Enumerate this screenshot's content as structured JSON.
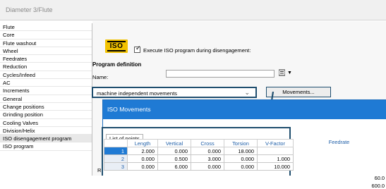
{
  "window": {
    "title": "Diameter 3/Flute"
  },
  "sidebar": {
    "items": [
      {
        "label": "Flute",
        "selected": false
      },
      {
        "label": "Core",
        "selected": false
      },
      {
        "label": "Flute washout",
        "selected": false
      },
      {
        "label": "Wheel",
        "selected": false
      },
      {
        "label": "Feedrates",
        "selected": false
      },
      {
        "label": "Reduction",
        "selected": false
      },
      {
        "label": "Cycles/Infeed",
        "selected": false
      },
      {
        "label": "AC",
        "selected": false
      },
      {
        "label": "Increments",
        "selected": false
      },
      {
        "label": "General",
        "selected": false
      },
      {
        "label": "Change positions",
        "selected": false
      },
      {
        "label": "Grinding position",
        "selected": false
      },
      {
        "label": "Cooling Valves",
        "selected": false
      },
      {
        "label": "Division/Helix",
        "selected": false
      },
      {
        "label": "ISO disengagement program",
        "selected": true
      },
      {
        "label": "ISO program",
        "selected": false
      }
    ]
  },
  "main": {
    "logo_text": "ISO",
    "execute_checkbox": {
      "checked": true,
      "label": "Execute ISO program during disengagement:"
    },
    "section_title": "Program definition",
    "name_label": "Name:",
    "name_value": "",
    "select_value": "machine independent movements",
    "movements_button": "Movements...",
    "side_letter": "R"
  },
  "dialog": {
    "title": "ISO Movements",
    "tab_label": "List of points",
    "columns": [
      "Length",
      "Vertical",
      "Cross",
      "Torsion",
      "V-Factor"
    ],
    "feedrate_header": "Feedrate",
    "rows": [
      {
        "index": "1",
        "cells": [
          "2.000",
          "0.000",
          "0.000",
          "18.000",
          ""
        ],
        "feedrate": ""
      },
      {
        "index": "2",
        "cells": [
          "0.000",
          "0.500",
          "3.000",
          "0.000",
          "1.000"
        ],
        "feedrate": "60.0"
      },
      {
        "index": "3",
        "cells": [
          "0.000",
          "6.000",
          "0.000",
          "0.000",
          "10.000"
        ],
        "feedrate": "600.0"
      }
    ]
  },
  "colors": {
    "accent": "#1f7ad4",
    "highlight_border": "#1f4e6e",
    "logo_yellow": "#f2c200"
  }
}
